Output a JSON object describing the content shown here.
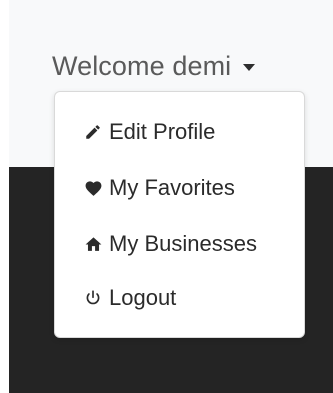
{
  "header": {
    "welcome_label": "Welcome demi"
  },
  "user_menu": {
    "items": [
      {
        "label": "Edit Profile",
        "icon": "pencil-icon"
      },
      {
        "label": "My Favorites",
        "icon": "heart-icon"
      },
      {
        "label": "My Businesses",
        "icon": "home-icon"
      },
      {
        "label": "Logout",
        "icon": "power-icon"
      }
    ]
  },
  "colors": {
    "header_background": "#f8f9fa",
    "page_dark_background": "#242424",
    "menu_background": "#ffffff",
    "welcome_text": "#5a5a5a",
    "menu_text": "#2b2b2b"
  }
}
